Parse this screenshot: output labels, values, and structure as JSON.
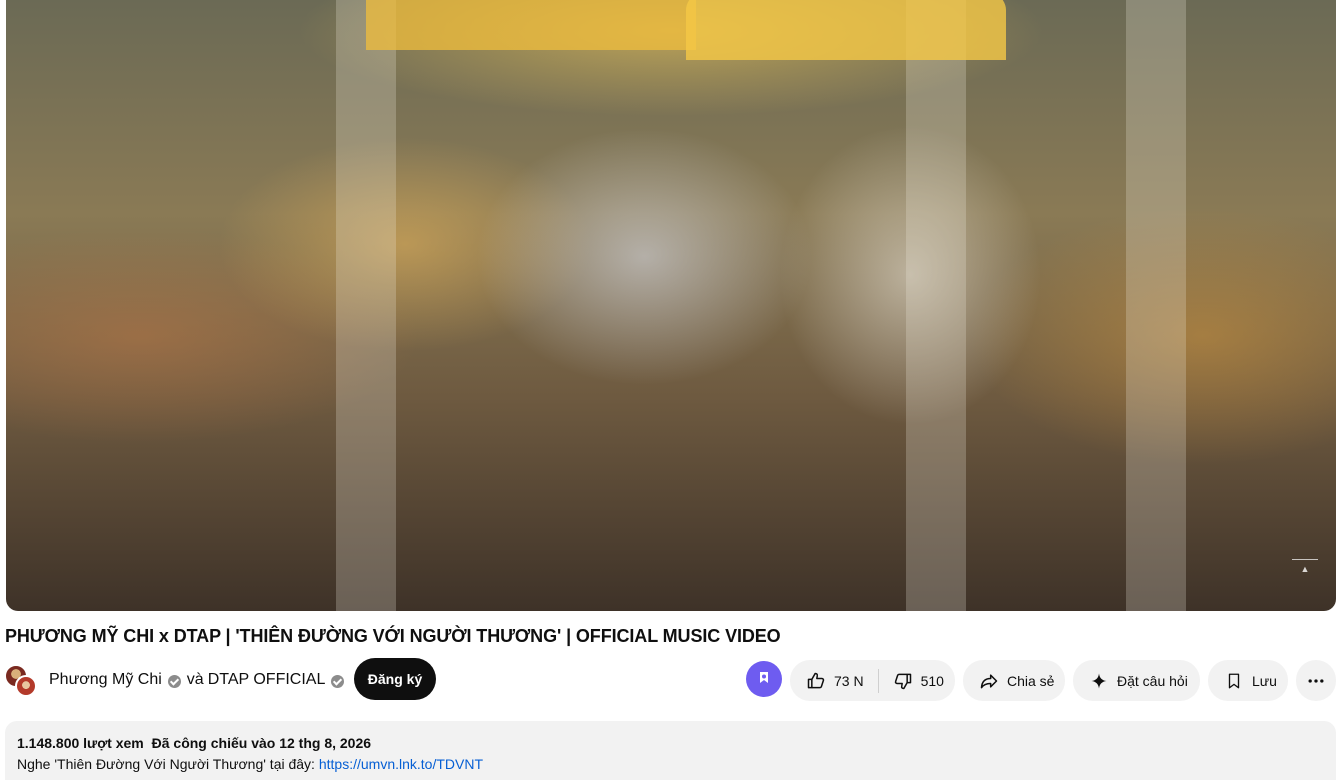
{
  "video": {
    "title": "PHƯƠNG MỸ CHI x DTAP | 'THIÊN ĐƯỜNG VỚI NGƯỜI THƯƠNG' | OFFICIAL MUSIC VIDEO"
  },
  "owner": {
    "channel1": "Phương Mỹ Chi",
    "connector": "và",
    "channel2": "DTAP OFFICIAL",
    "subscribe_label": "Đăng ký"
  },
  "actions": {
    "like_count": "73 N",
    "dislike_count": "510",
    "share_label": "Chia sẻ",
    "ask_label": "Đặt câu hỏi",
    "save_label": "Lưu"
  },
  "description": {
    "views": "1.148.800 lượt xem",
    "date": "Đã công chiếu vào 12 thg 8, 2026",
    "text": "Nghe 'Thiên Đường Với Người Thương' tại đây: ",
    "link": "https://umvn.lnk.to/TDVNT"
  },
  "icons": [
    "thanks-icon",
    "like-icon",
    "dislike-icon",
    "share-icon",
    "sparkle-icon",
    "bookmark-icon",
    "more-icon",
    "verified-icon"
  ],
  "colors": {
    "accent": "#065fd4",
    "subscribe_bg": "#0f0f0f",
    "chip_bg": "#f2f2f2",
    "thanks": "#6e5cf0"
  }
}
